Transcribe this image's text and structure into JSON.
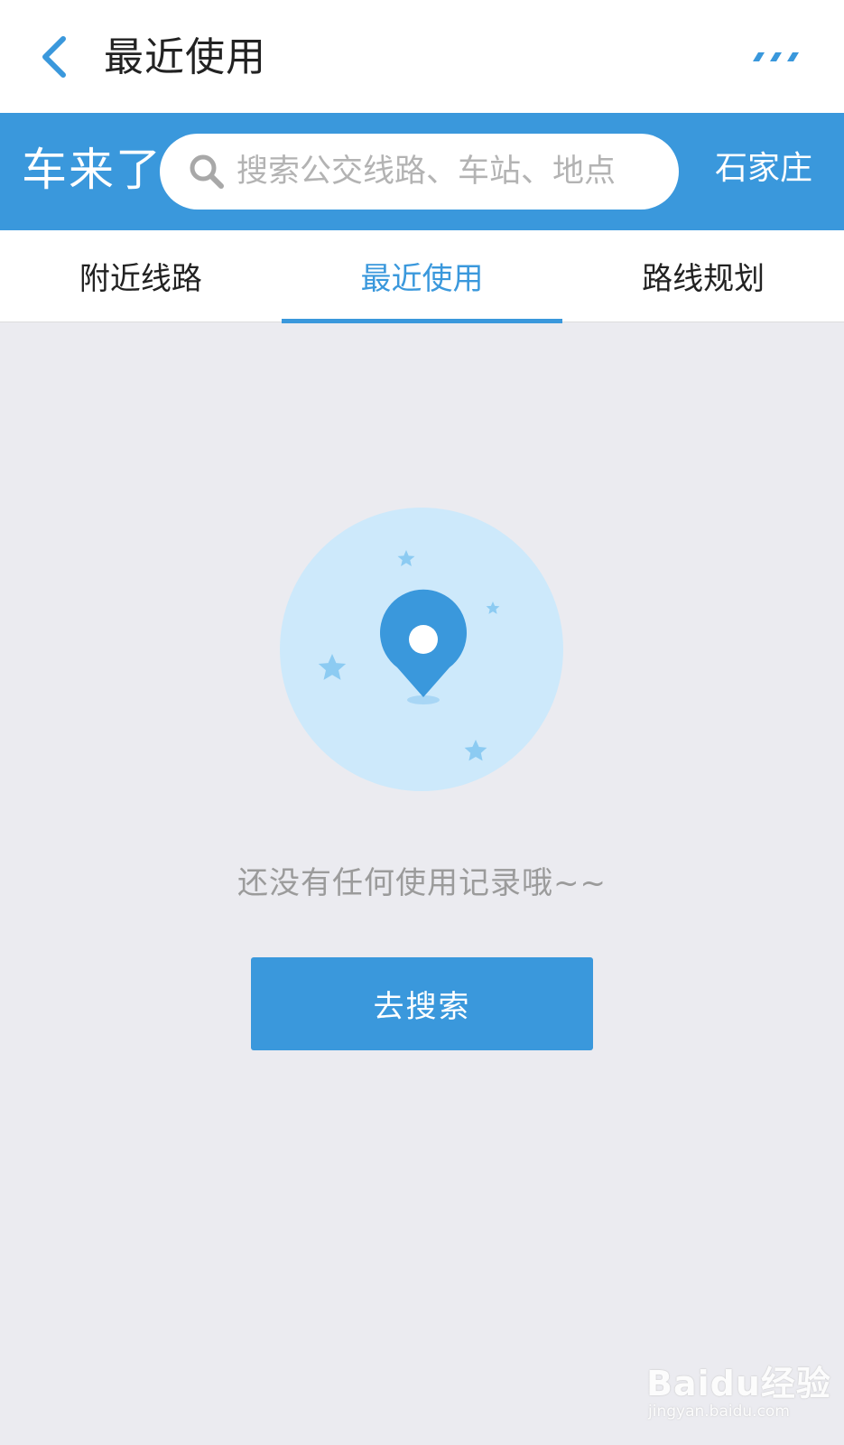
{
  "titlebar": {
    "back_icon": "chevron-left-icon",
    "title": "最近使用",
    "more_icon": "more-dots-icon"
  },
  "search_header": {
    "brand": "车来了",
    "search_placeholder": "搜索公交线路、车站、地点",
    "search_icon": "search-icon",
    "city": "石家庄"
  },
  "tabs": [
    {
      "label": "附近线路",
      "active": false
    },
    {
      "label": "最近使用",
      "active": true
    },
    {
      "label": "路线规划",
      "active": false
    }
  ],
  "empty_state": {
    "illustration_icon": "location-pin-icon",
    "message": "还没有任何使用记录哦~~",
    "button_label": "去搜索"
  },
  "watermark": {
    "brand": "Baidu经验",
    "url": "jingyan.baidu.com"
  },
  "colors": {
    "accent": "#3a98dc",
    "background": "#ebebf0",
    "illustration_circle": "#cde9fb",
    "star": "#8ccbf2"
  }
}
